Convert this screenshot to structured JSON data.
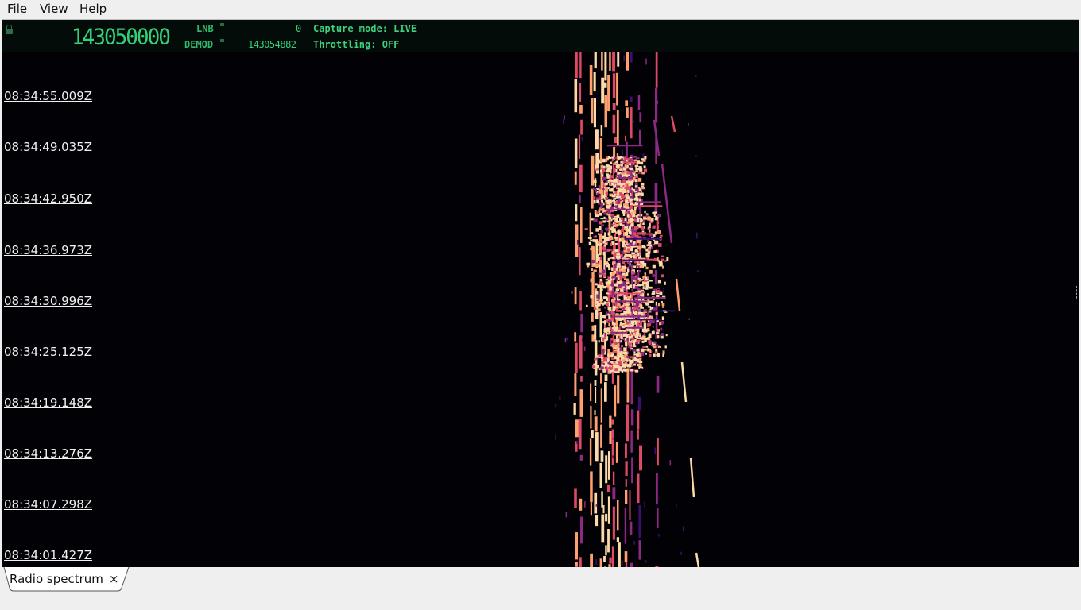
{
  "menu": [
    {
      "label": "File"
    },
    {
      "label": "View"
    },
    {
      "label": "Help"
    }
  ],
  "header": {
    "main_frequency": "143050000",
    "lnb_label": "LNB",
    "lnb_value": "0",
    "demod_label": "DEMOD",
    "demod_value": "143054882",
    "capture_mode": "Capture mode: LIVE",
    "throttling": "Throttling: OFF",
    "lcd_color": "#35d07a"
  },
  "waterfall": {
    "timestamps": [
      "08:34:55.009Z",
      "08:34:49.035Z",
      "08:34:42.950Z",
      "08:34:36.973Z",
      "08:34:30.996Z",
      "08:34:25.125Z",
      "08:34:19.148Z",
      "08:34:13.276Z",
      "08:34:07.298Z",
      "08:34:01.427Z"
    ],
    "colormap": [
      "#020206",
      "#3b0f70",
      "#8c2981",
      "#de4968",
      "#fe9f6d",
      "#fcd9a8"
    ]
  },
  "tabs": [
    {
      "label": "Radio spectrum",
      "close": "×"
    }
  ]
}
